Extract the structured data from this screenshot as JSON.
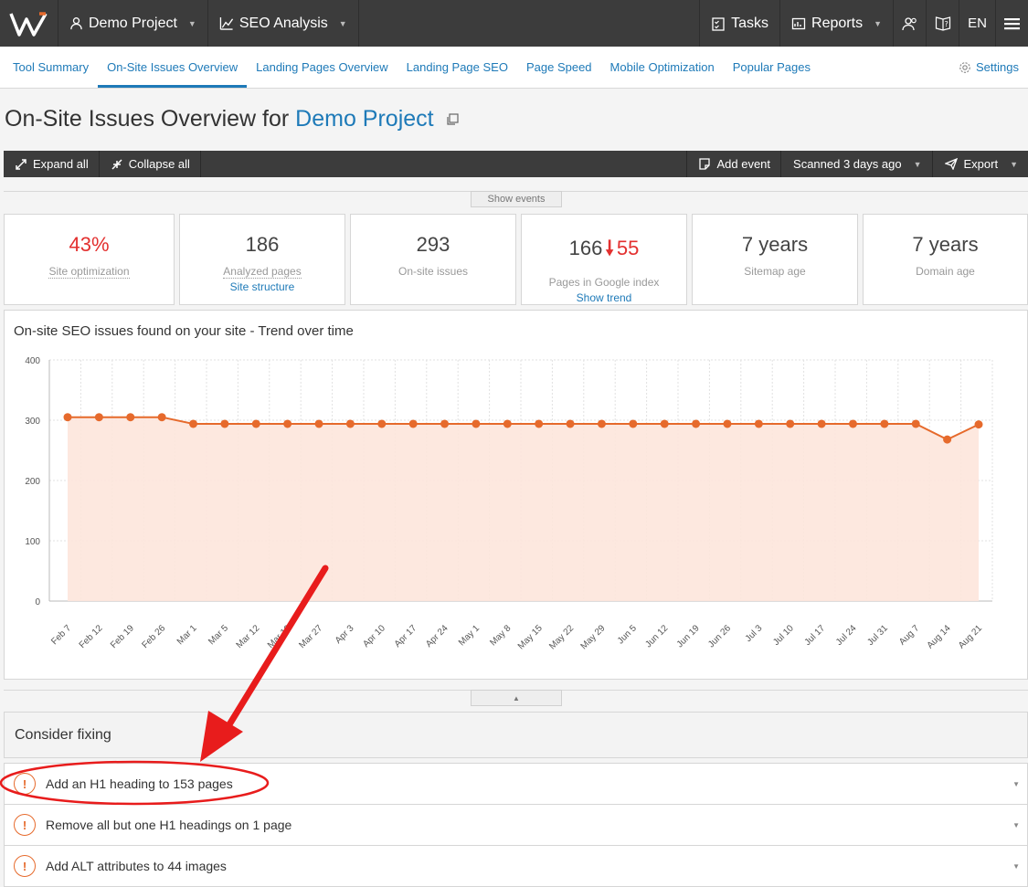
{
  "topbar": {
    "project": "Demo Project",
    "module": "SEO Analysis",
    "tasks": "Tasks",
    "reports": "Reports",
    "lang": "EN"
  },
  "subnav": {
    "tabs": [
      "Tool Summary",
      "On-Site Issues Overview",
      "Landing Pages Overview",
      "Landing Page SEO",
      "Page Speed",
      "Mobile Optimization",
      "Popular Pages"
    ],
    "active": "On-Site Issues Overview",
    "settings": "Settings"
  },
  "title": {
    "prefix": "On-Site Issues Overview for ",
    "project": "Demo Project"
  },
  "toolbar": {
    "expand": "Expand all",
    "collapse": "Collapse all",
    "add_event": "Add event",
    "scanned": "Scanned 3 days ago",
    "export": "Export"
  },
  "show_events": "Show events",
  "cards": [
    {
      "value": "43%",
      "label": "Site optimization",
      "link": ""
    },
    {
      "value": "186",
      "label": "Analyzed pages",
      "link": "Site structure"
    },
    {
      "value": "293",
      "label": "On-site issues",
      "link": ""
    },
    {
      "value": "166",
      "value_change": "55",
      "label": "Pages in Google index",
      "link": "Show trend"
    },
    {
      "value": "7 years",
      "label": "Sitemap age",
      "link": ""
    },
    {
      "value": "7 years",
      "label": "Domain age",
      "link": ""
    }
  ],
  "colors": {
    "accent": "#1e7ab8",
    "series": "#e66a2c",
    "fill": "#fde6dc",
    "danger": "#e3302f",
    "annotation": "#e81c1c"
  },
  "chart_data": {
    "type": "area",
    "title": "On-site SEO issues found on your site - Trend over time",
    "x": [
      "Feb 7",
      "Feb 12",
      "Feb 19",
      "Feb 26",
      "Mar 1",
      "Mar 5",
      "Mar 12",
      "Mar 19",
      "Mar 27",
      "Apr 3",
      "Apr 10",
      "Apr 17",
      "Apr 24",
      "May 1",
      "May 8",
      "May 15",
      "May 22",
      "May 29",
      "Jun 5",
      "Jun 12",
      "Jun 19",
      "Jun 26",
      "Jul 3",
      "Jul 10",
      "Jul 17",
      "Jul 24",
      "Jul 31",
      "Aug 7",
      "Aug 14",
      "Aug 21"
    ],
    "series": [
      {
        "name": "",
        "values": [
          305,
          305,
          305,
          305,
          294,
          294,
          294,
          294,
          294,
          294,
          294,
          294,
          294,
          294,
          294,
          294,
          294,
          294,
          294,
          294,
          294,
          294,
          294,
          294,
          294,
          294,
          294,
          294,
          268,
          293
        ]
      }
    ],
    "ylim": [
      0,
      400
    ],
    "yticks": [
      0,
      100,
      200,
      300,
      400
    ],
    "grid": true,
    "xlabel": "",
    "ylabel": ""
  },
  "fix": {
    "heading": "Consider fixing",
    "items": [
      "Add an H1 heading to 153 pages",
      "Remove all but one H1 headings on 1 page",
      "Add ALT attributes to 44 images"
    ]
  }
}
